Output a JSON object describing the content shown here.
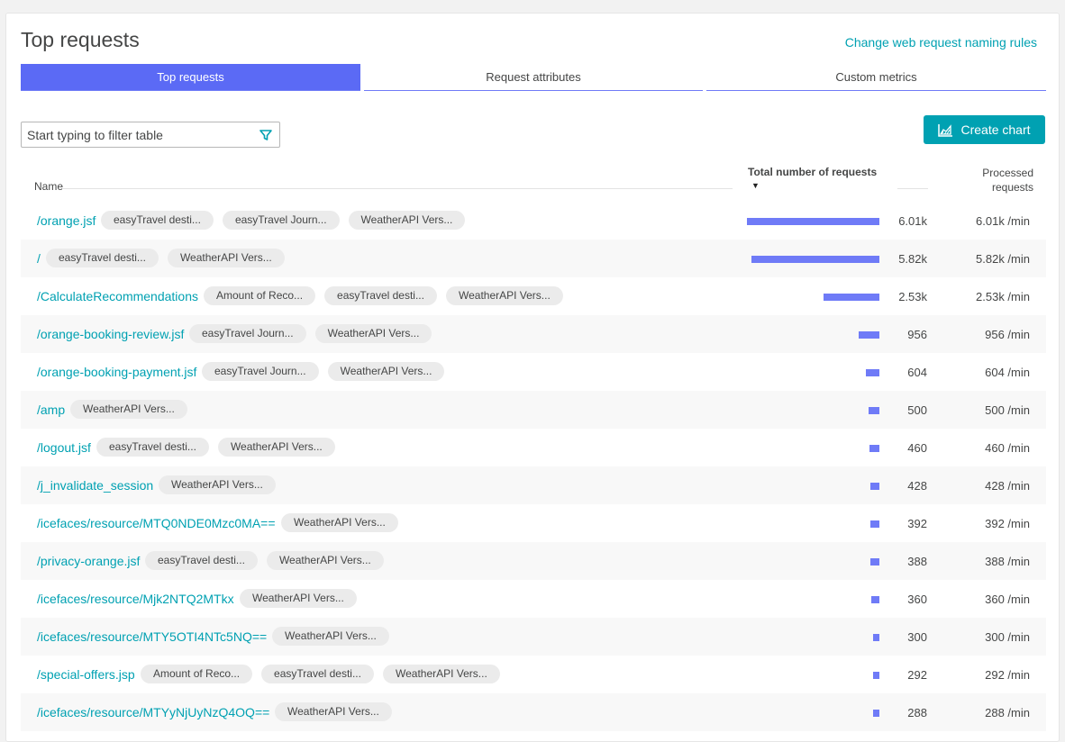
{
  "header": {
    "title": "Top requests",
    "naming_rules_link": "Change web request naming rules"
  },
  "tabs": [
    {
      "label": "Top requests",
      "active": true
    },
    {
      "label": "Request attributes",
      "active": false
    },
    {
      "label": "Custom metrics",
      "active": false
    }
  ],
  "filter": {
    "placeholder": "Start typing to filter table",
    "value": ""
  },
  "create_chart": {
    "label": "Create chart",
    "icon": "area-chart-icon"
  },
  "table": {
    "columns": {
      "name": "Name",
      "total": "Total number of requests",
      "processed": "Processed requests",
      "sort_indicator": "▼"
    },
    "rows": [
      {
        "name": "/orange.jsf",
        "tags": [
          "easyTravel desti...",
          "easyTravel Journ...",
          "WeatherAPI Vers..."
        ],
        "count": "6.01k",
        "rate": "6.01k /min",
        "share": 1.0
      },
      {
        "name": "/",
        "tags": [
          "easyTravel desti...",
          "WeatherAPI Vers..."
        ],
        "count": "5.82k",
        "rate": "5.82k /min",
        "share": 0.968
      },
      {
        "name": "/CalculateRecommendations",
        "tags": [
          "Amount of Reco...",
          "easyTravel desti...",
          "WeatherAPI Vers..."
        ],
        "count": "2.53k",
        "rate": "2.53k /min",
        "share": 0.421
      },
      {
        "name": "/orange-booking-review.jsf",
        "tags": [
          "easyTravel Journ...",
          "WeatherAPI Vers..."
        ],
        "count": "956",
        "rate": "956 /min",
        "share": 0.159
      },
      {
        "name": "/orange-booking-payment.jsf",
        "tags": [
          "easyTravel Journ...",
          "WeatherAPI Vers..."
        ],
        "count": "604",
        "rate": "604 /min",
        "share": 0.1
      },
      {
        "name": "/amp",
        "tags": [
          "WeatherAPI Vers..."
        ],
        "count": "500",
        "rate": "500 /min",
        "share": 0.083
      },
      {
        "name": "/logout.jsf",
        "tags": [
          "easyTravel desti...",
          "WeatherAPI Vers..."
        ],
        "count": "460",
        "rate": "460 /min",
        "share": 0.077
      },
      {
        "name": "/j_invalidate_session",
        "tags": [
          "WeatherAPI Vers..."
        ],
        "count": "428",
        "rate": "428 /min",
        "share": 0.071
      },
      {
        "name": "/icefaces/resource/MTQ0NDE0Mzc0MA==",
        "tags": [
          "WeatherAPI Vers..."
        ],
        "count": "392",
        "rate": "392 /min",
        "share": 0.065
      },
      {
        "name": "/privacy-orange.jsf",
        "tags": [
          "easyTravel desti...",
          "WeatherAPI Vers..."
        ],
        "count": "388",
        "rate": "388 /min",
        "share": 0.065
      },
      {
        "name": "/icefaces/resource/Mjk2NTQ2MTkx",
        "tags": [
          "WeatherAPI Vers..."
        ],
        "count": "360",
        "rate": "360 /min",
        "share": 0.06
      },
      {
        "name": "/icefaces/resource/MTY5OTI4NTc5NQ==",
        "tags": [
          "WeatherAPI Vers..."
        ],
        "count": "300",
        "rate": "300 /min",
        "share": 0.05
      },
      {
        "name": "/special-offers.jsp",
        "tags": [
          "Amount of Reco...",
          "easyTravel desti...",
          "WeatherAPI Vers..."
        ],
        "count": "292",
        "rate": "292 /min",
        "share": 0.049
      },
      {
        "name": "/icefaces/resource/MTYyNjUyNzQ4OQ==",
        "tags": [
          "WeatherAPI Vers..."
        ],
        "count": "288",
        "rate": "288 /min",
        "share": 0.048
      }
    ]
  },
  "colors": {
    "accent": "#5b6af5",
    "bar": "#6f7bf7",
    "link": "#00a1b2",
    "button": "#00a1b2"
  }
}
